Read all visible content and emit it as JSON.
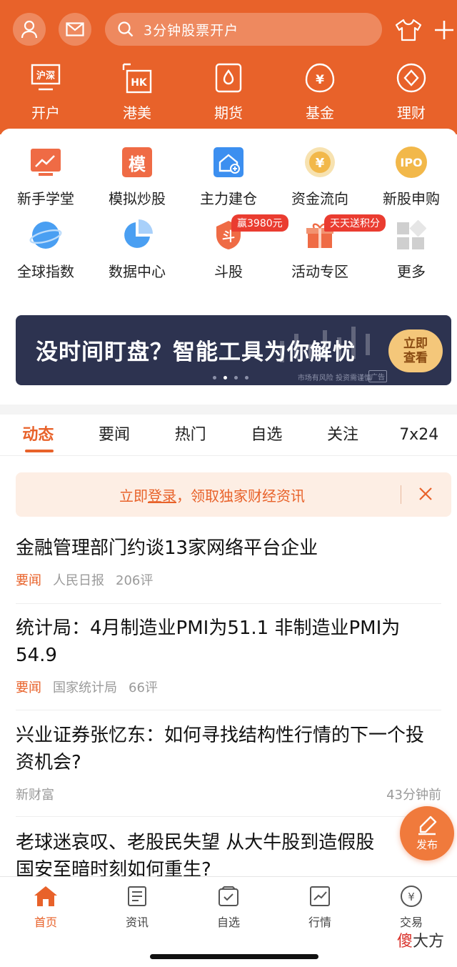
{
  "colors": {
    "brand": "#e8622a",
    "badge": "#ea3c30",
    "banner_bg": "#2d3350"
  },
  "header": {
    "search_placeholder": "3分钟股票开户",
    "nav": [
      {
        "label": "开户",
        "icon": "shanghai-shenzhen-icon"
      },
      {
        "label": "港美",
        "icon": "hk-us-icon"
      },
      {
        "label": "期货",
        "icon": "futures-icon"
      },
      {
        "label": "基金",
        "icon": "fund-icon"
      },
      {
        "label": "理财",
        "icon": "wealth-icon"
      }
    ]
  },
  "grid": {
    "row1": [
      {
        "label": "新手学堂",
        "icon": "chart-board-icon"
      },
      {
        "label": "模拟炒股",
        "icon": "simulate-icon",
        "icon_text": "模"
      },
      {
        "label": "主力建仓",
        "icon": "house-icon"
      },
      {
        "label": "资金流向",
        "icon": "coin-flow-icon"
      },
      {
        "label": "新股申购",
        "icon": "ipo-icon",
        "icon_text": "IPO"
      }
    ],
    "row2": [
      {
        "label": "全球指数",
        "icon": "globe-icon"
      },
      {
        "label": "数据中心",
        "icon": "pie-chart-icon"
      },
      {
        "label": "斗股",
        "icon": "dou-gu-icon",
        "badge": "赢3980元"
      },
      {
        "label": "活动专区",
        "icon": "gift-icon",
        "badge": "天天送积分"
      },
      {
        "label": "更多",
        "icon": "more-grid-icon"
      }
    ]
  },
  "banner": {
    "text": "没时间盯盘？智能工具为你解忧",
    "button_line1": "立即",
    "button_line2": "查看",
    "note": "市场有风险 投资需谨慎",
    "ad": "广告"
  },
  "tabs": [
    "动态",
    "要闻",
    "热门",
    "自选",
    "关注",
    "7x24"
  ],
  "tip": {
    "prefix": "立即",
    "link": "登录",
    "suffix": "，领取独家财经资讯"
  },
  "news": [
    {
      "title": "金融管理部门约谈13家网络平台企业",
      "tag": "要闻",
      "source": "人民日报",
      "comments": "206评"
    },
    {
      "title": "统计局：4月制造业PMI为51.1 非制造业PMI为54.9",
      "tag": "要闻",
      "source": "国家统计局",
      "comments": "66评"
    },
    {
      "title": "兴业证券张忆东：如何寻找结构性行情的下一个投资机会?",
      "source": "新财富",
      "time": "43分钟前"
    },
    {
      "title": "老球迷哀叹、老股民失望 从大牛股到造假股 国安至暗时刻如何重生?"
    }
  ],
  "fab": {
    "label": "发布"
  },
  "bottom_nav": [
    {
      "label": "首页",
      "icon": "home-icon"
    },
    {
      "label": "资讯",
      "icon": "news-icon"
    },
    {
      "label": "自选",
      "icon": "watchlist-icon"
    },
    {
      "label": "行情",
      "icon": "market-icon"
    },
    {
      "label": "交易",
      "icon": "trade-icon"
    }
  ],
  "watermark": {
    "red": "傻",
    "rest": "大方"
  }
}
